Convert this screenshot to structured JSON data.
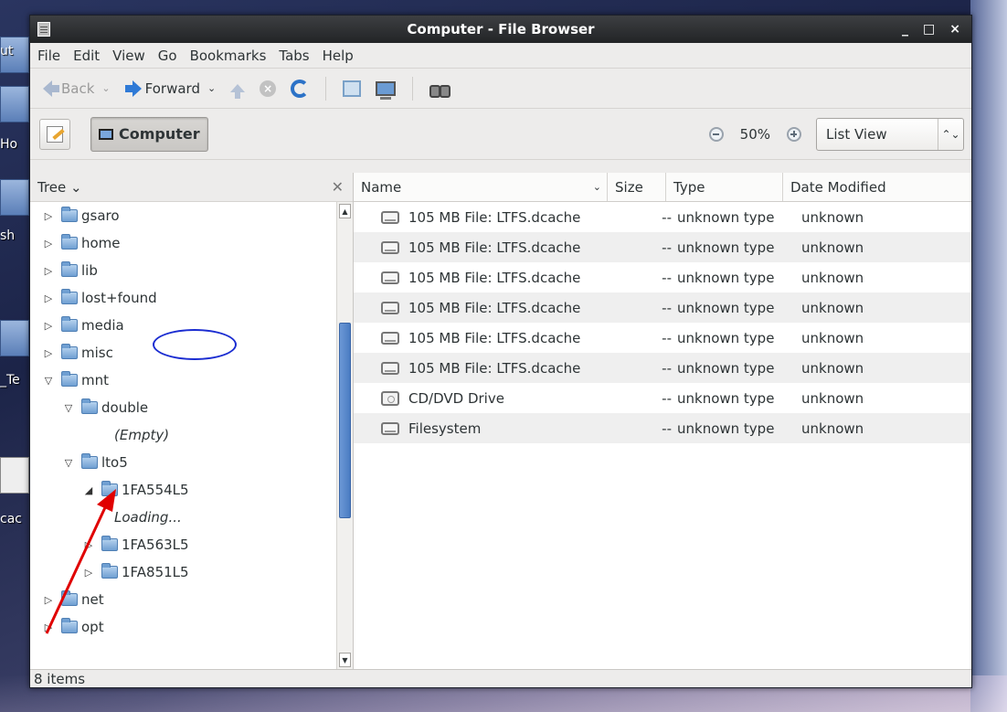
{
  "window": {
    "title": "Computer - File Browser",
    "controls": [
      "_",
      "□",
      "×"
    ]
  },
  "menu": [
    "File",
    "Edit",
    "View",
    "Go",
    "Bookmarks",
    "Tabs",
    "Help"
  ],
  "toolbar": {
    "back_label": "Back",
    "forward_label": "Forward",
    "icons": [
      "back-arrow-icon",
      "forward-arrow-icon",
      "up-arrow-icon",
      "stop-icon",
      "reload-icon",
      "home-icon",
      "computer-icon",
      "search-icon"
    ]
  },
  "location": {
    "crumb_label": "Computer",
    "zoom_level": "50%",
    "view_mode": "List View"
  },
  "sidebar": {
    "mode": "Tree",
    "tree": [
      {
        "label": "gsaro",
        "expander": "▷",
        "indent": 0,
        "italic": false
      },
      {
        "label": "home",
        "expander": "▷",
        "indent": 0,
        "italic": false
      },
      {
        "label": "lib",
        "expander": "▷",
        "indent": 0,
        "italic": false
      },
      {
        "label": "lost+found",
        "expander": "▷",
        "indent": 0,
        "italic": false
      },
      {
        "label": "media",
        "expander": "▷",
        "indent": 0,
        "italic": false
      },
      {
        "label": "misc",
        "expander": "▷",
        "indent": 0,
        "italic": false
      },
      {
        "label": "mnt",
        "expander": "▽",
        "indent": 0,
        "italic": false
      },
      {
        "label": "double",
        "expander": "▽",
        "indent": 1,
        "italic": false
      },
      {
        "label": "(Empty)",
        "expander": "",
        "indent": 3,
        "italic": true
      },
      {
        "label": "lto5",
        "expander": "▽",
        "indent": 1,
        "italic": false
      },
      {
        "label": "1FA554L5",
        "expander": "◢",
        "indent": 2,
        "italic": false
      },
      {
        "label": "Loading...",
        "expander": "",
        "indent": 3,
        "italic": true
      },
      {
        "label": "1FA563L5",
        "expander": "▷",
        "indent": 2,
        "italic": false
      },
      {
        "label": "1FA851L5",
        "expander": "▷",
        "indent": 2,
        "italic": false
      },
      {
        "label": "net",
        "expander": "▷",
        "indent": 0,
        "italic": false
      },
      {
        "label": "opt",
        "expander": "▷",
        "indent": 0,
        "italic": false
      }
    ]
  },
  "columns": {
    "name": "Name",
    "size": "Size",
    "type": "Type",
    "date": "Date Modified"
  },
  "files": [
    {
      "name": "105 MB File: LTFS.dcache",
      "size": "--",
      "type": "unknown type",
      "date": "unknown",
      "icon": "drive-icon"
    },
    {
      "name": "105 MB File: LTFS.dcache",
      "size": "--",
      "type": "unknown type",
      "date": "unknown",
      "icon": "drive-icon"
    },
    {
      "name": "105 MB File: LTFS.dcache",
      "size": "--",
      "type": "unknown type",
      "date": "unknown",
      "icon": "drive-icon"
    },
    {
      "name": "105 MB File: LTFS.dcache",
      "size": "--",
      "type": "unknown type",
      "date": "unknown",
      "icon": "drive-icon"
    },
    {
      "name": "105 MB File: LTFS.dcache",
      "size": "--",
      "type": "unknown type",
      "date": "unknown",
      "icon": "drive-icon"
    },
    {
      "name": "105 MB File: LTFS.dcache",
      "size": "--",
      "type": "unknown type",
      "date": "unknown",
      "icon": "drive-icon"
    },
    {
      "name": "CD/DVD Drive",
      "size": "--",
      "type": "unknown type",
      "date": "unknown",
      "icon": "optical-drive-icon"
    },
    {
      "name": "Filesystem",
      "size": "--",
      "type": "unknown type",
      "date": "unknown",
      "icon": "drive-icon"
    }
  ],
  "status": "8 items",
  "desktop_labels": [
    "ut",
    "Ho",
    "sh",
    "_Te",
    "cac"
  ]
}
